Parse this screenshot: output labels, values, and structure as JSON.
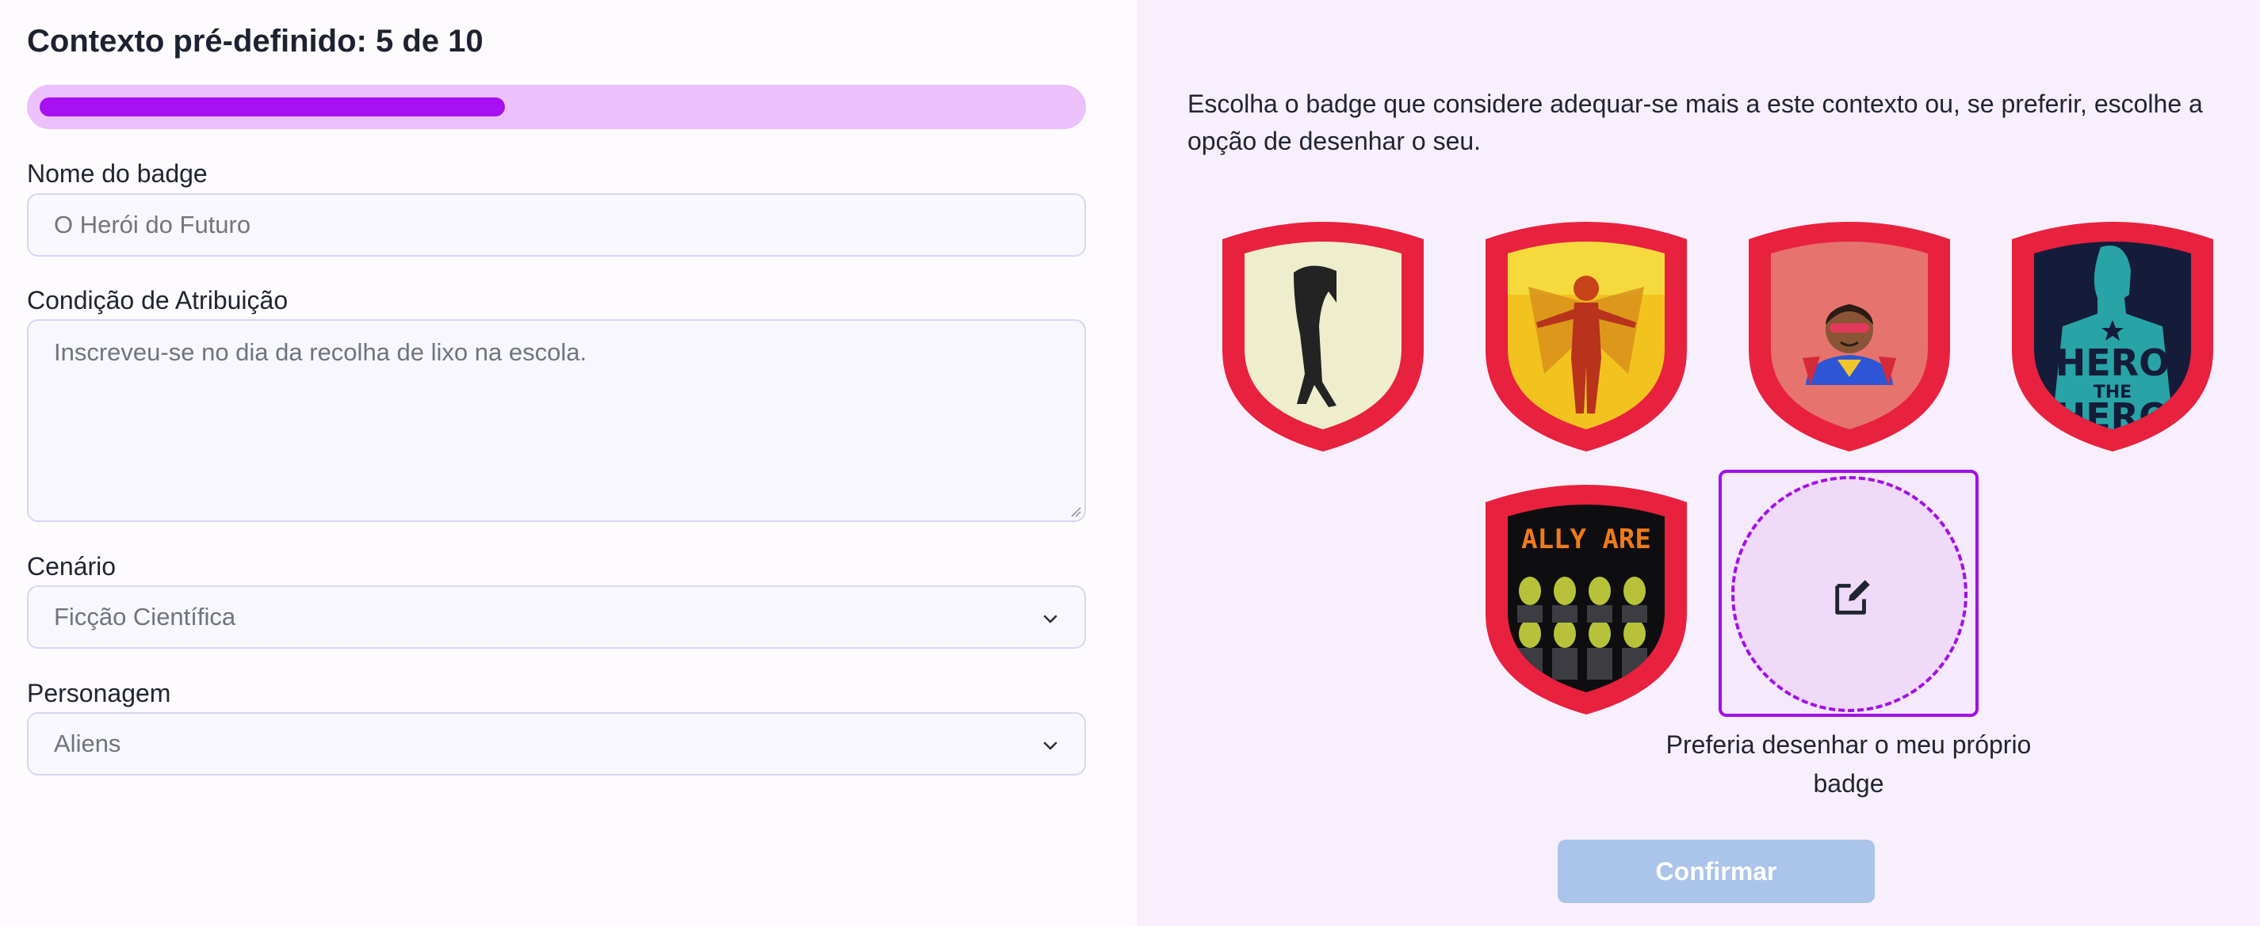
{
  "form": {
    "title": "Contexto pré-definido: 5 de 10",
    "progress": {
      "current": 5,
      "total": 10,
      "fraction": 0.45
    },
    "badge_name": {
      "label": "Nome do badge",
      "placeholder": "O Herói do Futuro"
    },
    "condition": {
      "label": "Condição de Atribuição",
      "placeholder": "Inscreveu-se no dia da recolha de lixo na escola."
    },
    "scenario": {
      "label": "Cenário",
      "value": "Ficção Científica"
    },
    "character": {
      "label": "Personagem",
      "value": "Aliens"
    }
  },
  "picker": {
    "instructions": "Escolha o badge que considere adequar-se mais a este contexto ou, se preferir, escolhe a opção de desenhar o seu.",
    "badges": [
      {
        "name": "hunched-figure"
      },
      {
        "name": "winged-hero-mosaic"
      },
      {
        "name": "masked-kid-hero"
      },
      {
        "name": "hero-the-hero",
        "text_line1": "HERO",
        "text_line2": "THE",
        "text_line3": "HERO"
      },
      {
        "name": "pixel-aliens",
        "text": "ALLY ARE"
      }
    ],
    "draw_option": {
      "label": "Preferia desenhar o meu próprio badge",
      "icon": "edit-icon"
    },
    "confirm_label": "Confirmar"
  },
  "colors": {
    "accent": "#a20fe6",
    "badge_border": "#e8213f",
    "confirm_disabled": "#aac4ea"
  }
}
